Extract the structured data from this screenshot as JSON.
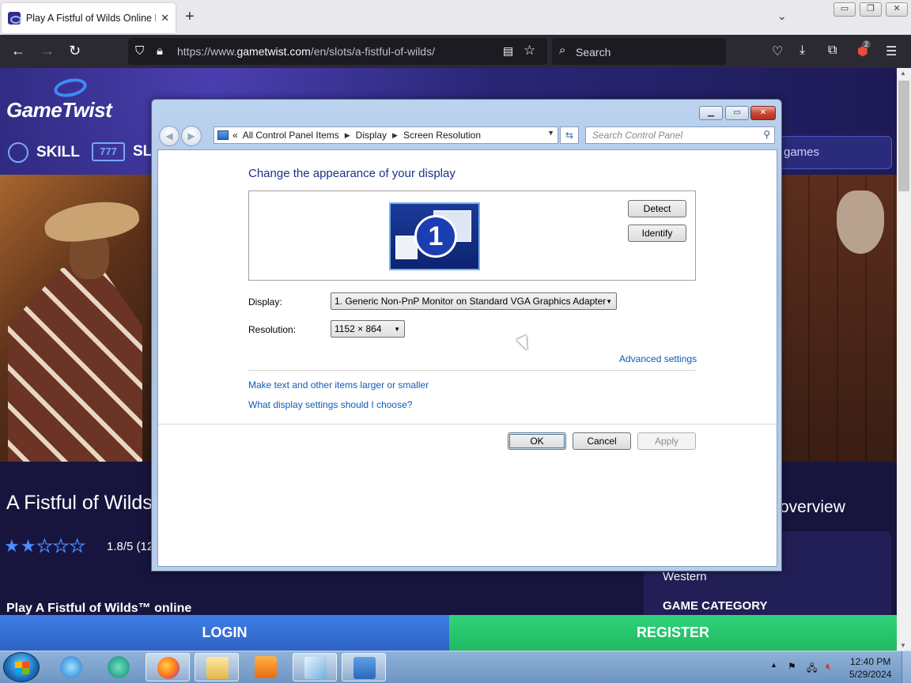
{
  "browser": {
    "tab_title": "Play A Fistful of Wilds Online F",
    "url_prefix": "https://www.",
    "url_host": "gametwist.com",
    "url_path": "/en/slots/a-fistful-of-wilds/",
    "search_placeholder": "Search",
    "extension_badge": "2"
  },
  "page": {
    "logo_text": "GameTwist",
    "categories": {
      "skill": "SKILL",
      "slots": "SL"
    },
    "slots_icon_text": "777",
    "search_games": "games",
    "game_title": "A Fistful of Wilds",
    "rating_text": "1.8/5 (12",
    "rating_value": 1.8,
    "rating_max": 5,
    "play_heading": "Play A Fistful of Wilds™ online",
    "overview_heading": "overview",
    "theme_value": "Western",
    "game_category_label": "GAME CATEGORY",
    "login_label": "LOGIN",
    "register_label": "REGISTER",
    "colors": {
      "login": "#3d7ee8",
      "register": "#2fd47a"
    }
  },
  "dialog": {
    "breadcrumb": [
      "All Control Panel Items",
      "Display",
      "Screen Resolution"
    ],
    "breadcrumb_lead": "«",
    "search_placeholder": "Search Control Panel",
    "heading": "Change the appearance of your display",
    "monitor_number": "1",
    "detect_label": "Detect",
    "identify_label": "Identify",
    "display_label": "Display:",
    "display_value": "1. Generic Non-PnP Monitor on Standard VGA Graphics Adapter",
    "resolution_label": "Resolution:",
    "resolution_value": "1152 × 864",
    "advanced_link": "Advanced settings",
    "text_size_link": "Make text and other items larger or smaller",
    "help_link": "What display settings should I choose?",
    "ok_label": "OK",
    "cancel_label": "Cancel",
    "apply_label": "Apply"
  },
  "taskbar": {
    "time": "12:40 PM",
    "date": "5/29/2024"
  }
}
